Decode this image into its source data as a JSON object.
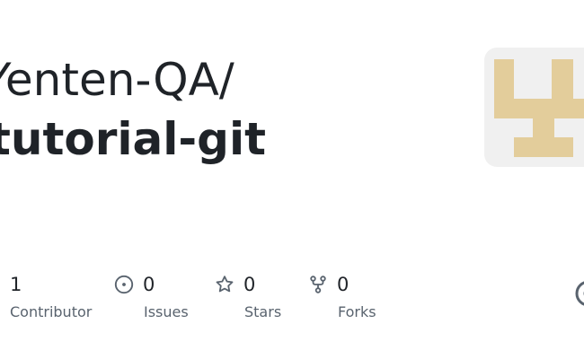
{
  "repo": {
    "owner": "Yenten-QA/",
    "name": "tutorial-git"
  },
  "stats": {
    "contributors": {
      "count": "1",
      "label": "Contributor"
    },
    "issues": {
      "count": "0",
      "label": "Issues",
      "icon": "issue-opened-icon"
    },
    "stars": {
      "count": "0",
      "label": "Stars",
      "icon": "star-icon"
    },
    "forks": {
      "count": "0",
      "label": "Forks",
      "icon": "repo-forked-icon"
    }
  },
  "colors": {
    "avatar_bg": "#f0f0f0",
    "avatar_glyph": "#e3cd9b",
    "text": "#1f2328",
    "muted": "#59636e"
  },
  "icons": {
    "avatar": "identicon",
    "edge": "github-icon"
  }
}
